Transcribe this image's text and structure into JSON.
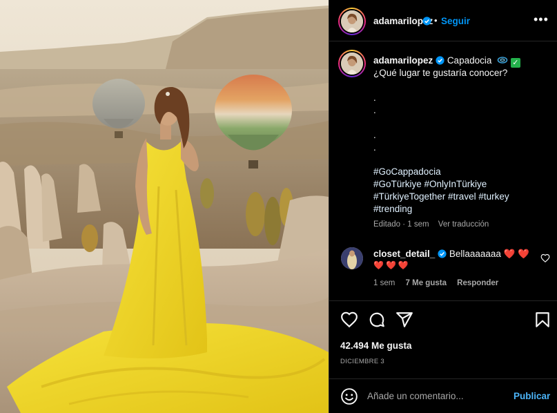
{
  "post": {
    "username": "adamarilopez",
    "follow_label": "Seguir",
    "separator": "•",
    "more_label": "•••"
  },
  "caption": {
    "username": "adamarilopez",
    "location_text": "Capadocia",
    "question": "¿Qué lugar te gustaría conocer?",
    "dots": [
      ".",
      ".",
      ".",
      "."
    ],
    "hashtag_lines": [
      "#GoCappadocia",
      "#GoTürkiye #OnlyInTürkiye",
      "#TürkiyeTogether #travel #turkey",
      "#trending"
    ],
    "edited_label": "Editado",
    "edited_time": "1 sem",
    "translate_label": "Ver traducción",
    "check_emoji": "✓"
  },
  "comment": {
    "username": "closet_detail_",
    "text": "Bellaaaaaaa",
    "hearts_inline": "❤️ ❤️",
    "hearts_line2": "❤️❤️❤️",
    "time": "1 sem",
    "likes": "7 Me gusta",
    "reply_label": "Responder"
  },
  "engagement": {
    "likes_text": "42.494 Me gusta",
    "date_text": "DICIEMBRE 3"
  },
  "composer": {
    "placeholder": "Añade un comentario...",
    "post_label": "Publicar"
  },
  "icons": {
    "like": "heart-icon",
    "comment": "comment-icon",
    "share": "share-icon",
    "save": "bookmark-icon",
    "emoji": "smile-icon",
    "verified": "verified-badge-icon",
    "location_swirl": "swirl-emoji-icon"
  },
  "colors": {
    "background": "#000000",
    "link_blue": "#0095f6",
    "hashtag": "#e0f1ff",
    "muted": "#a8a8a8",
    "heart_red": "#ff3040",
    "verified_blue": "#0095f6"
  }
}
